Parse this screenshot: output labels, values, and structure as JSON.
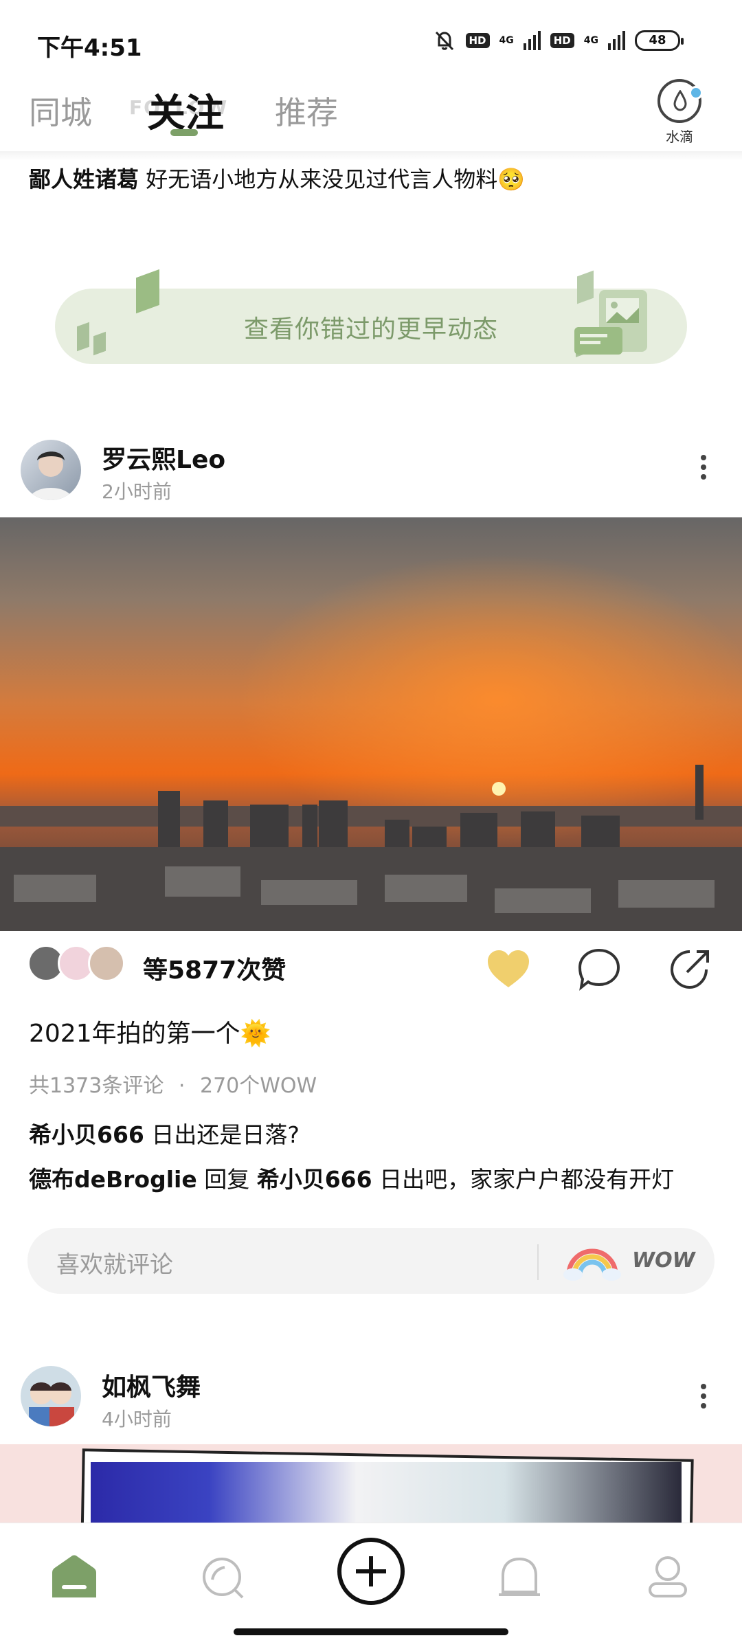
{
  "status_bar": {
    "time": "下午4:51",
    "hd1": "HD",
    "net1": "4G",
    "hd2": "HD",
    "net2": "4G",
    "battery": "48"
  },
  "tabs": [
    {
      "label": "同城",
      "active": false
    },
    {
      "label": "关注",
      "active": true
    },
    {
      "label": "推荐",
      "active": false
    }
  ],
  "tab_ghost": "FOLLOW",
  "water_drop": {
    "label": "水滴"
  },
  "top_comment": {
    "user": "鄙人姓诸葛",
    "text": " 好无语小地方从来没见过代言人物料",
    "emoji": "🥺"
  },
  "banner": {
    "text": "查看你错过的更早动态"
  },
  "post1": {
    "username": "罗云熙Leo",
    "time": "2小时前",
    "likes": "等5877次赞",
    "caption": "2021年拍的第一个",
    "caption_emoji": "🌞",
    "comments_count": "共1373条评论",
    "dot": "·",
    "wow_count": "270个WOW",
    "comments": [
      {
        "user": "希小贝666",
        "text": " 日出还是日落?"
      },
      {
        "user": "德布deBroglie",
        "mid": " 回复 ",
        "reply_to": "希小贝666",
        "text": " 日出吧，家家户户都没有开灯"
      }
    ],
    "comment_placeholder": "喜欢就评论",
    "wow_label": "WOW"
  },
  "post2": {
    "username": "如枫飞舞",
    "time": "4小时前"
  },
  "colors": {
    "accent": "#7da068",
    "heart": "#f0cf6d",
    "banner_bg": "#e7eedf",
    "banner_text": "#7c9a6a"
  },
  "nav_icons": [
    "home-icon",
    "discover-icon",
    "add-icon",
    "notification-bell-icon",
    "profile-icon"
  ]
}
